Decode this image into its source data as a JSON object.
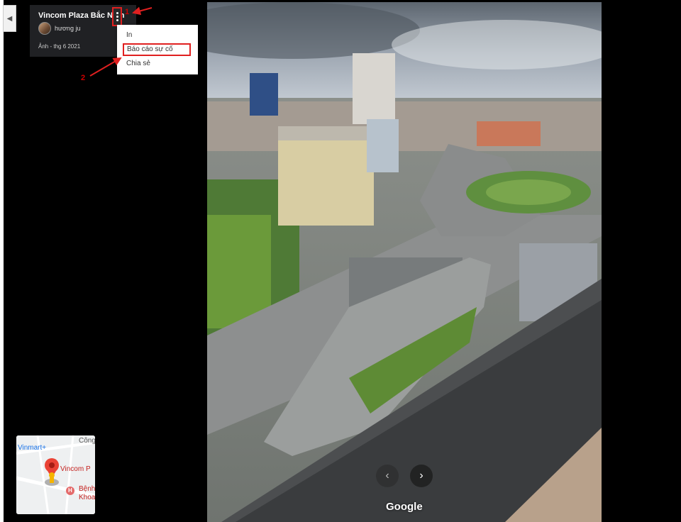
{
  "place": {
    "title": "Vincom Plaza Bắc Ninh",
    "author": "hương ju",
    "date": "Ảnh - thg 6 2021"
  },
  "menu": {
    "items": [
      {
        "label": "In"
      },
      {
        "label": "Báo cáo sự cố"
      },
      {
        "label": "Chia sẻ"
      }
    ]
  },
  "annotations": {
    "step1": "1",
    "step2": "2",
    "color": "#e02020"
  },
  "photo_nav": {
    "prev_icon": "chevron-left-icon",
    "next_icon": "chevron-right-icon"
  },
  "branding": {
    "logo_text": "Google"
  },
  "minimap": {
    "label_vinmart": "Vinmart+",
    "label_cong": "Công",
    "label_vincom": "Vincom P",
    "label_hospital_1": "Bệnh",
    "label_hospital_2": "Khoa",
    "hospital_letter": "H"
  }
}
